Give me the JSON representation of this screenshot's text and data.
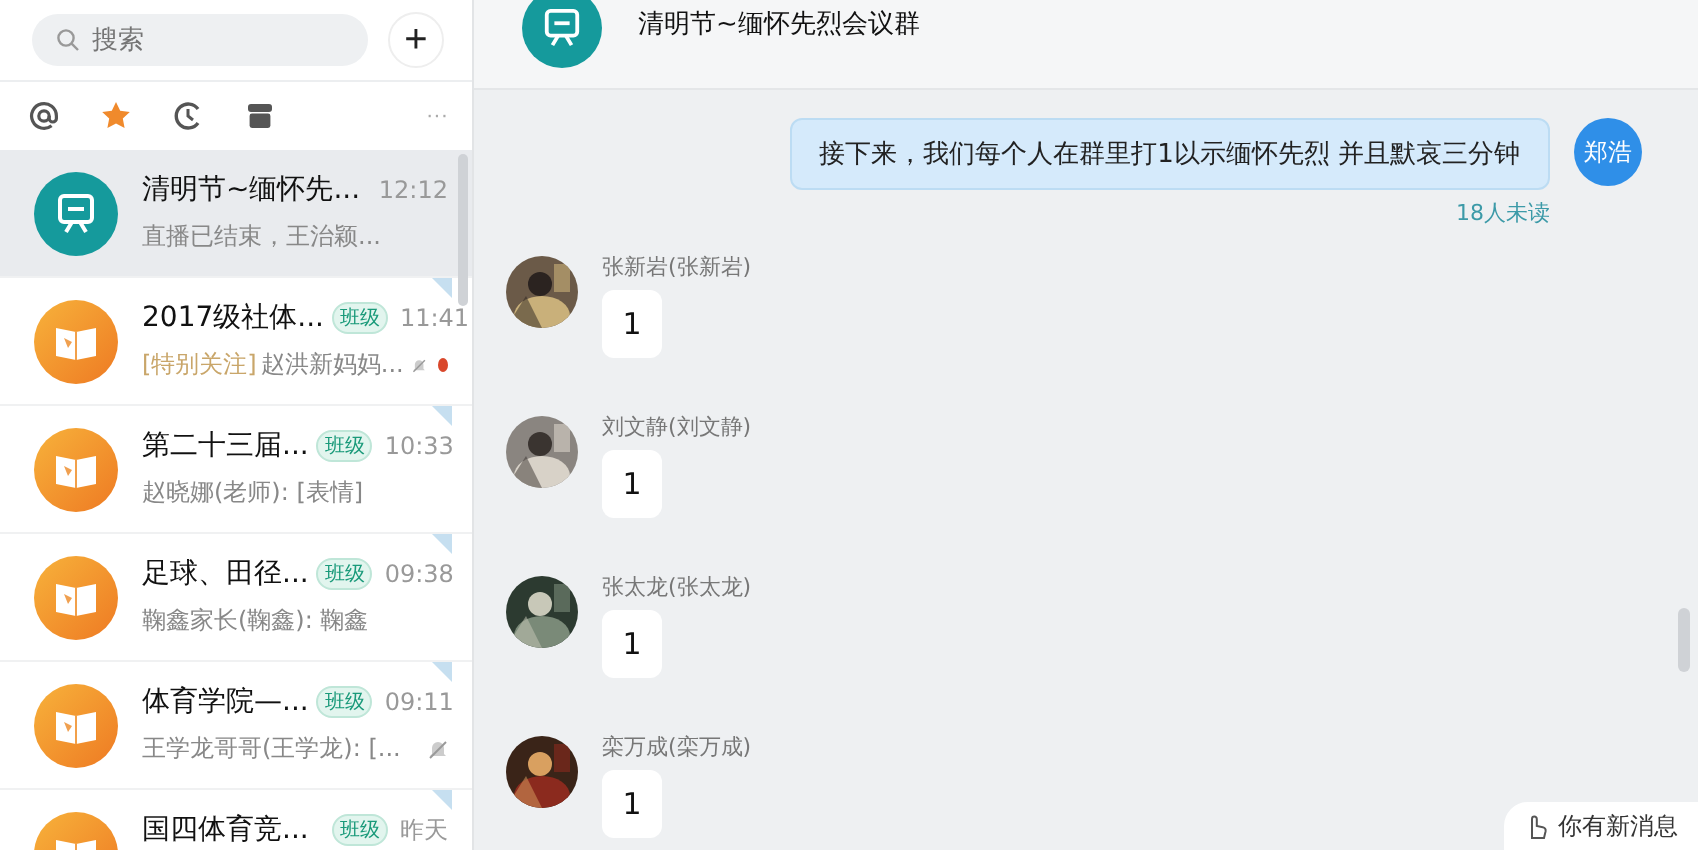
{
  "search": {
    "placeholder": "搜索",
    "add_label": "+"
  },
  "filter_tabs": [
    {
      "kind": "at",
      "selected": false
    },
    {
      "kind": "star",
      "selected": true
    },
    {
      "kind": "recent",
      "selected": false
    },
    {
      "kind": "archive",
      "selected": false
    },
    {
      "kind": "more",
      "label": "···",
      "selected": false
    }
  ],
  "conversations": [
    {
      "kind": "meeting",
      "name": "清明节~缅怀先...",
      "time": "12:12",
      "preview": "直播已结束，王治颖...",
      "selected": true,
      "pinned": false,
      "muted": false,
      "unread": false
    },
    {
      "kind": "class",
      "name": "2017级社体...",
      "tag": "班级",
      "time": "11:41",
      "highlight": "[特别关注]",
      "preview": "赵洪新妈妈...",
      "selected": false,
      "pinned": true,
      "muted": true,
      "unread": true
    },
    {
      "kind": "class",
      "name": "第二十三届...",
      "tag": "班级",
      "time": "10:33",
      "preview": "赵晓娜(老师): [表情]",
      "selected": false,
      "pinned": true,
      "muted": false,
      "unread": false
    },
    {
      "kind": "class",
      "name": "足球、田径...",
      "tag": "班级",
      "time": "09:38",
      "preview": "鞠鑫家长(鞠鑫): 鞠鑫",
      "selected": false,
      "pinned": true,
      "muted": false,
      "unread": false
    },
    {
      "kind": "class",
      "name": "体育学院—...",
      "tag": "班级",
      "time": "09:11",
      "preview": "王学龙哥哥(王学龙): [...",
      "selected": false,
      "pinned": true,
      "muted": true,
      "unread": false
    },
    {
      "kind": "class",
      "name": "国四体育竞...",
      "tag": "班级",
      "time": "昨天",
      "selected": false,
      "pinned": true,
      "muted": false,
      "unread": false
    }
  ],
  "chat": {
    "title": "清明节~缅怀先烈会议群",
    "messages": [
      {
        "kind": "outgoing",
        "avatar_text": "郑浩",
        "text": "接下来，我们每个人在群里打1以示缅怀先烈  并且默哀三分钟",
        "receipt": "18人未读"
      },
      {
        "kind": "incoming",
        "sender": "张新岩(张新岩)",
        "text": "1"
      },
      {
        "kind": "incoming",
        "sender": "刘文静(刘文静)",
        "text": "1"
      },
      {
        "kind": "incoming",
        "sender": "张太龙(张太龙)",
        "text": "1"
      },
      {
        "kind": "incoming",
        "sender": "栾万成(栾万成)",
        "text": "1"
      }
    ],
    "new_message_notice": "你有新消息"
  }
}
